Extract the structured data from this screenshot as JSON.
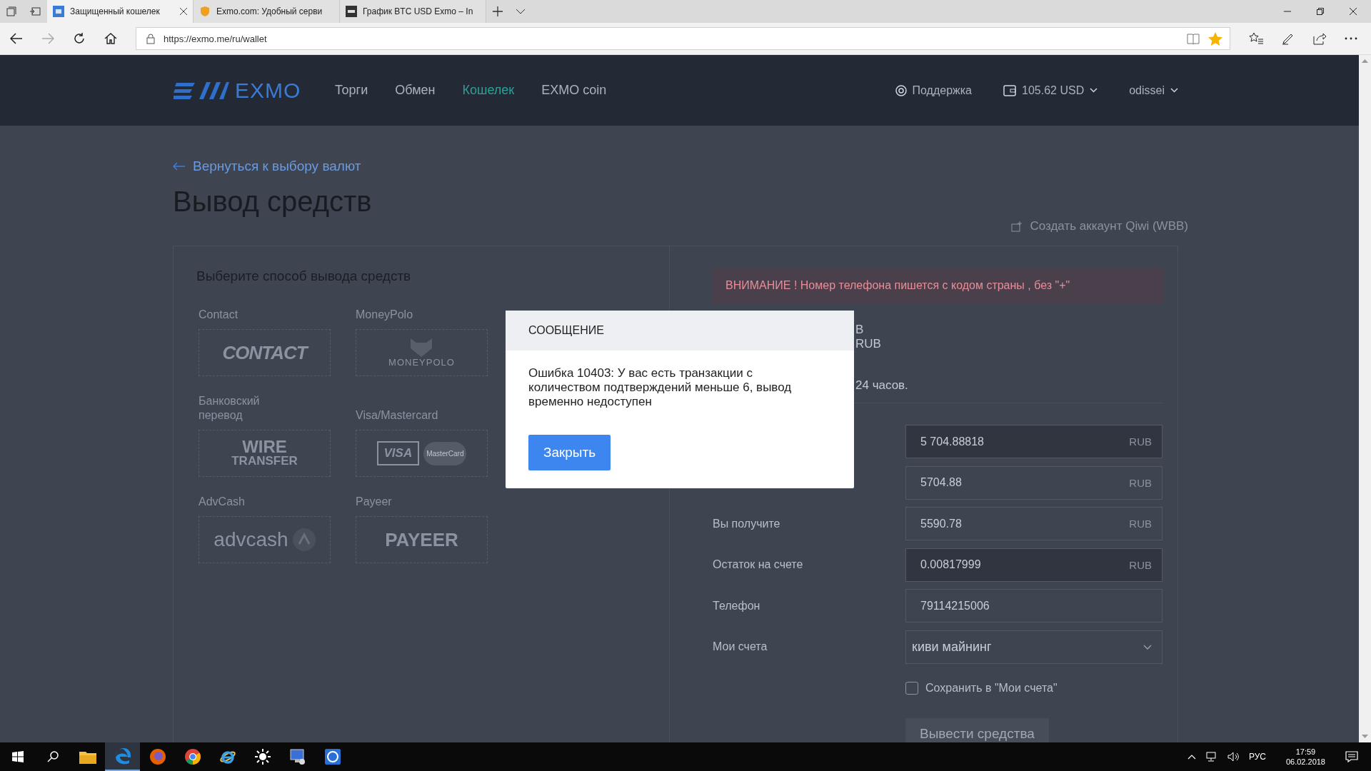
{
  "browser": {
    "tabs": [
      {
        "title": "Защищенный кошелек",
        "kind": "exmo",
        "selected": true
      },
      {
        "title": "Exmo.com: Удобный серви",
        "kind": "shield",
        "selected": false
      },
      {
        "title": "График BTC USD Exmo – In",
        "kind": "investing",
        "selected": false
      }
    ],
    "url": "https://exmo.me/ru/wallet"
  },
  "site_nav": {
    "logo": "EXMO",
    "menu": [
      {
        "label": "Торги",
        "selected": false
      },
      {
        "label": "Обмен",
        "selected": false
      },
      {
        "label": "Кошелек",
        "selected": true
      },
      {
        "label": "EXMO coin",
        "selected": false
      }
    ],
    "support": "Поддержка",
    "balance": "105.62 USD",
    "user": "odissei"
  },
  "page": {
    "back_link": "Вернуться к выбору валют",
    "title": "Вывод средств",
    "create_account_link": "Создать аккаунт Qiwi (WBB)"
  },
  "methods": {
    "heading": "Выберите способ вывода средств",
    "items": [
      {
        "label": "Contact",
        "kind": "contact",
        "logo_text": [
          "CONTACT"
        ]
      },
      {
        "label": "MoneyPolo",
        "kind": "moneypolo",
        "logo_text": [
          "MONEYPOLO"
        ]
      },
      {
        "label": "Банковский перевод",
        "kind": "wire",
        "logo_text": [
          "WIRE",
          "TRANSFER"
        ]
      },
      {
        "label": "Visa/Mastercard",
        "kind": "cards",
        "logo_text": [
          "VISA",
          "MasterCard"
        ]
      },
      {
        "label": "AdvCash",
        "kind": "advcash",
        "logo_text": [
          "advcash"
        ]
      },
      {
        "label": "Payeer",
        "kind": "payeer",
        "logo_text": [
          "PAYEER"
        ]
      }
    ]
  },
  "warning": "ВНИМАНИЕ ! Номер телефона пишется с кодом страны , без \"+\"",
  "info_fragments": [
    "B",
    "RUB",
    "24 часов."
  ],
  "form": {
    "rows": [
      {
        "kind": "field",
        "value": "5 704.88818",
        "unit": "RUB",
        "readonly": true
      },
      {
        "kind": "field",
        "value": "5704.88",
        "unit": "RUB",
        "readonly": false
      },
      {
        "kind": "field",
        "label": "Вы получите",
        "value": "5590.78",
        "unit": "RUB",
        "readonly": false
      },
      {
        "kind": "field",
        "label": "Остаток на счете",
        "value": "0.00817999",
        "unit": "RUB",
        "readonly": true
      },
      {
        "kind": "field",
        "label": "Телефон",
        "value": "79114215006",
        "readonly": false
      },
      {
        "kind": "select",
        "label": "Мои счета",
        "value": "киви майнинг"
      }
    ],
    "save_checkbox": {
      "label": "Сохранить в \"Мои счета\"",
      "checked": false
    },
    "submit": "Вывести средства"
  },
  "modal": {
    "title": "СООБЩЕНИЕ",
    "message": "Ошибка 10403: У вас есть транзакции с количеством подтверждений меньше 6, вывод временно недоступен",
    "button": "Закрыть"
  },
  "taskbar": {
    "apps": [
      {
        "kind": "explorer",
        "selected": false
      },
      {
        "kind": "edge",
        "selected": true
      },
      {
        "kind": "firefox",
        "selected": false
      },
      {
        "kind": "chrome",
        "selected": false
      },
      {
        "kind": "ie",
        "selected": false
      },
      {
        "kind": "brightness",
        "selected": false
      },
      {
        "kind": "monitor",
        "selected": false
      },
      {
        "kind": "wallet",
        "selected": false
      }
    ],
    "language": "РУС",
    "time": "17:59",
    "date": "06.02.2018"
  }
}
